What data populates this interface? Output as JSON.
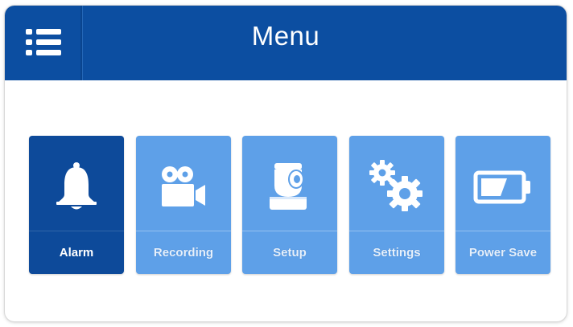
{
  "header": {
    "title": "Menu",
    "menu_icon": "hamburger-menu-icon",
    "background_color": "#0c4ea1"
  },
  "tiles": [
    {
      "label": "Alarm",
      "icon": "bell-icon",
      "selected": true,
      "color": "#0d4a9a"
    },
    {
      "label": "Recording",
      "icon": "video-camera-icon",
      "selected": false,
      "color": "#5ea0e8"
    },
    {
      "label": "Setup",
      "icon": "ptz-camera-icon",
      "selected": false,
      "color": "#5ea0e8"
    },
    {
      "label": "Settings",
      "icon": "gears-icon",
      "selected": false,
      "color": "#5ea0e8"
    },
    {
      "label": "Power Save",
      "icon": "battery-icon",
      "selected": false,
      "color": "#5ea0e8"
    }
  ]
}
